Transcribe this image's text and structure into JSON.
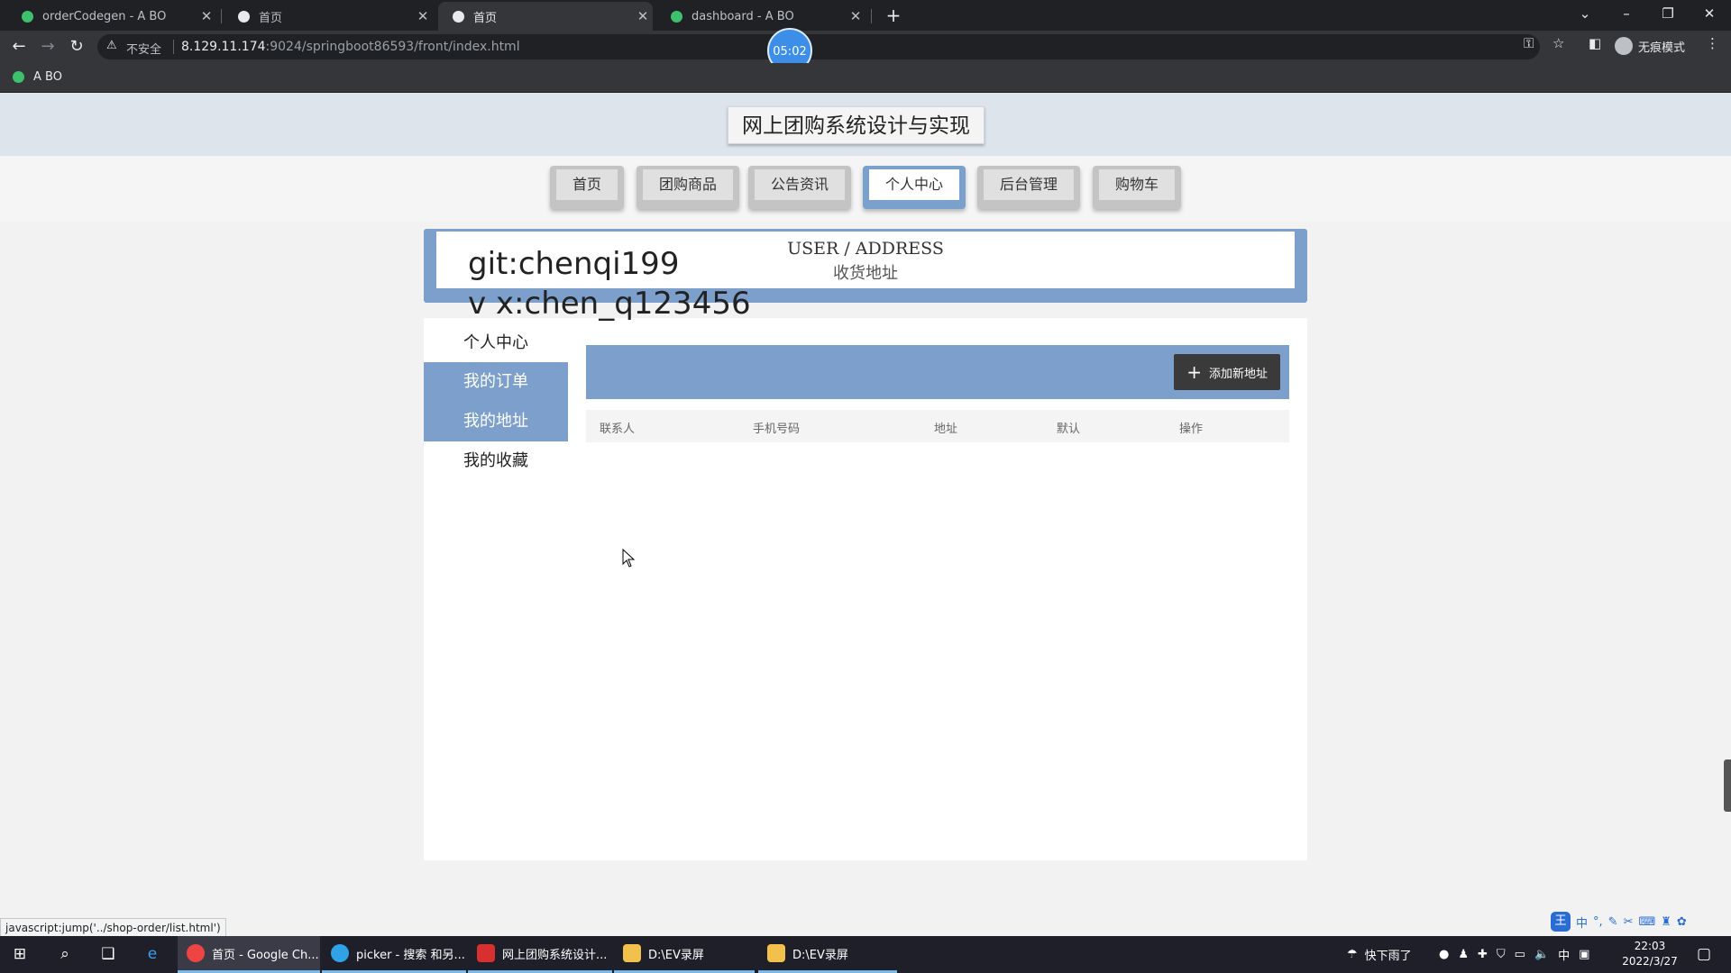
{
  "browser": {
    "tabs": [
      {
        "title": "orderCodegen - A BO",
        "icon": "leaf-icon",
        "active": false
      },
      {
        "title": "首页",
        "icon": "globe-icon",
        "active": false
      },
      {
        "title": "首页",
        "icon": "globe-icon",
        "active": true
      },
      {
        "title": "dashboard - A BO",
        "icon": "leaf-icon",
        "active": false
      }
    ],
    "new_tab": "+",
    "address": {
      "security_label": "不安全",
      "host": "8.129.11.174",
      "path": ":9024/springboot86593/front/index.html"
    },
    "timer": "05:02",
    "profile_label": "无痕模式",
    "bookmarks": [
      {
        "label": "A BO"
      }
    ],
    "status_text": "javascript:jump('../shop-order/list.html')"
  },
  "site": {
    "title": "网上团购系统设计与实现",
    "nav": [
      {
        "label": "首页"
      },
      {
        "label": "团购商品"
      },
      {
        "label": "公告资讯"
      },
      {
        "label": "个人中心"
      },
      {
        "label": "后台管理"
      },
      {
        "label": "购物车"
      }
    ],
    "active_nav": "个人中心",
    "breadcrumb_en": "USER / ADDRESS",
    "breadcrumb_cn": "收货地址",
    "watermark_lines": [
      "git:chenqi199",
      "v x:chen_q123456"
    ],
    "sidebar": [
      {
        "label": "个人中心",
        "active": false
      },
      {
        "label": "我的订单",
        "active": true
      },
      {
        "label": "我的地址",
        "active": true
      },
      {
        "label": "我的收藏",
        "active": false
      }
    ],
    "add_address_label": "添加新地址",
    "table_headers": [
      "联系人",
      "手机号码",
      "地址",
      "默认",
      "操作"
    ],
    "accent_color": "#7c9fcc"
  },
  "ime": {
    "logo": "王",
    "mode": "中"
  },
  "taskbar": {
    "apps": [
      {
        "label": "首页 - Google Ch...",
        "icon": "chrome-icon"
      },
      {
        "label": "picker - 搜索 和另...",
        "icon": "edge-icon"
      },
      {
        "label": "网上团购系统设计...",
        "icon": "app-icon"
      },
      {
        "label": "D:\\EV录屏",
        "icon": "folder-icon"
      },
      {
        "label": "D:\\EV录屏",
        "icon": "folder-icon"
      }
    ],
    "weather": "快下雨了",
    "input_lang": "中",
    "time": "22:03",
    "date": "2022/3/27"
  }
}
